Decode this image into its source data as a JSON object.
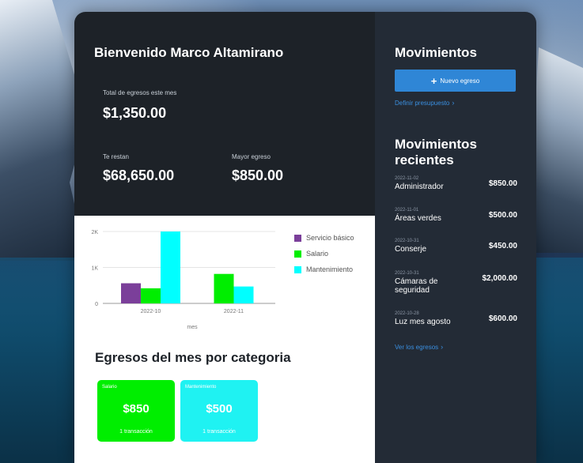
{
  "welcome": "Bienvenido Marco Altamirano",
  "stats": {
    "total_label": "Total de egresos este mes",
    "total_value": "$1,350.00",
    "remaining_label": "Te restan",
    "remaining_value": "$68,650.00",
    "max_label": "Mayor egreso",
    "max_value": "$850.00"
  },
  "chart_data": {
    "type": "bar",
    "categories": [
      "2022-10",
      "2022-11"
    ],
    "series": [
      {
        "name": "Servicio básico",
        "color": "#7b3f9a",
        "values": [
          560,
          0
        ]
      },
      {
        "name": "Salario",
        "color": "#00ee00",
        "values": [
          420,
          820
        ]
      },
      {
        "name": "Mantenimiento",
        "color": "#00ffff",
        "values": [
          2000,
          470
        ]
      }
    ],
    "xlabel": "mes",
    "ylabel": "",
    "ylim": [
      0,
      2000
    ],
    "yticks": [
      "0",
      "1K",
      "2K"
    ],
    "legend": "right"
  },
  "categories_title": "Egresos del mes por categoria",
  "category_cards": [
    {
      "name": "Salario",
      "amount": "$850",
      "count": "1 transacción",
      "color": "#00ee00"
    },
    {
      "name": "Mantenimiento",
      "amount": "$500",
      "count": "1 transacción",
      "color": "#1ff2f2"
    }
  ],
  "sidebar": {
    "title": "Movimientos",
    "new_button": "Nuevo egreso",
    "budget_link": "Definir presupuesto",
    "recent_title": "Movimientos recientes",
    "movements": [
      {
        "date": "2022-11-02",
        "name": "Administrador",
        "amount": "$850.00"
      },
      {
        "date": "2022-11-01",
        "name": "Áreas verdes",
        "amount": "$500.00"
      },
      {
        "date": "2022-10-31",
        "name": "Conserje",
        "amount": "$450.00"
      },
      {
        "date": "2022-10-31",
        "name": "Cámaras de seguridad",
        "amount": "$2,000.00"
      },
      {
        "date": "2022-10-28",
        "name": "Luz mes agosto",
        "amount": "$600.00"
      }
    ],
    "all_link": "Ver los egresos"
  },
  "icons": {
    "plus": "plus-icon",
    "chevron": "chevron-right-icon"
  }
}
